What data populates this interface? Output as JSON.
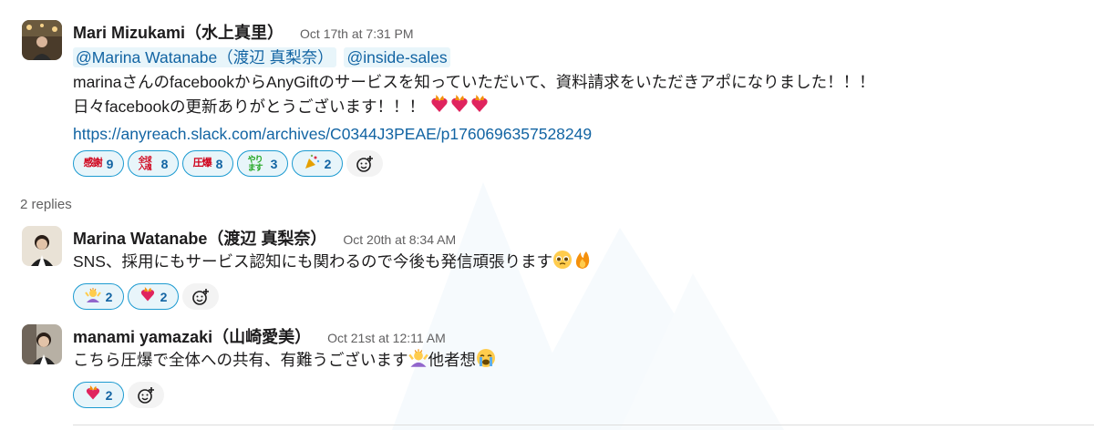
{
  "thread": {
    "parent": {
      "sender": "Mari Mizukami（水上真里）",
      "timestamp": "Oct 17th at 7:31 PM",
      "mentions": [
        "@Marina Watanabe（渡辺 真梨奈）",
        "@inside-sales"
      ],
      "text_line1": "marinaさんのfacebookからAnyGiftのサービスを知っていただいて、資料請求をいただきアポになりました！！！",
      "text_line2": "日々facebookの更新ありがとうございます！！！",
      "link": "https://anyreach.slack.com/archives/C0344J3PEAE/p1760696357528249",
      "reactions": [
        {
          "icon": "stamp-kansha-icon",
          "label": "感謝",
          "color": "#d0021b",
          "count": "9"
        },
        {
          "icon": "stamp-zenkyu-icon",
          "label": "全球入魂",
          "color": "#d0021b",
          "count": "8"
        },
        {
          "icon": "stamp-appaku-icon",
          "label": "圧爆",
          "color": "#d0021b",
          "count": "8"
        },
        {
          "icon": "stamp-yarimasu-icon",
          "label": "やります",
          "color": "#1fa51f",
          "count": "3"
        },
        {
          "icon": "party-popper-icon",
          "label": "",
          "color": "#e5a000",
          "count": "2"
        }
      ]
    },
    "replies_label": "2 replies",
    "replies": [
      {
        "sender": "Marina Watanabe（渡辺 真梨奈）",
        "timestamp": "Oct 20th at 8:34 AM",
        "text": "SNS、採用にもサービス認知にも関わるので今後も発信頑張ります",
        "reactions": [
          {
            "icon": "praising-person-icon",
            "count": "2"
          },
          {
            "icon": "heart-on-fire-icon",
            "count": "2"
          }
        ]
      },
      {
        "sender": "manami yamazaki（山崎愛美）",
        "timestamp": "Oct 21st at 12:11 AM",
        "text_before": "こちら圧爆で全体への共有、有難うございます",
        "text_after": "他者想",
        "reactions": [
          {
            "icon": "heart-on-fire-icon",
            "count": "2"
          }
        ]
      }
    ]
  },
  "colors": {
    "link": "#1264a3",
    "mention_bg": "#e8f5fa",
    "reaction_border": "#1d9bd1",
    "timestamp": "#616061"
  }
}
